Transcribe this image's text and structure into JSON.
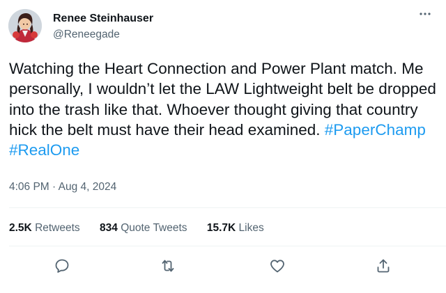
{
  "user": {
    "display_name": "Renee Steinhauser",
    "handle": "@Reneegade"
  },
  "tweet": {
    "text_main": "Watching the Heart Connection and Power Plant match. Me personally, I wouldn’t let the LAW Lightweight belt be dropped into the trash like that. Whoever thought giving that country hick the belt must have their head examined. ",
    "hashtags": [
      "#PaperChamp",
      "#RealOne"
    ]
  },
  "timestamp": "4:06 PM · Aug 4, 2024",
  "stats": {
    "retweets_count": "2.5K",
    "retweets_label": "Retweets",
    "quotes_count": "834",
    "quotes_label": "Quote Tweets",
    "likes_count": "15.7K",
    "likes_label": "Likes"
  },
  "icons": {
    "more": "more-horizontal-icon",
    "reply": "reply-icon",
    "retweet": "retweet-icon",
    "like": "heart-icon",
    "share": "share-icon"
  },
  "colors": {
    "link": "#1d9bf0",
    "secondary_text": "#536471",
    "primary_text": "#0f1419",
    "divider": "#eff3f4"
  }
}
